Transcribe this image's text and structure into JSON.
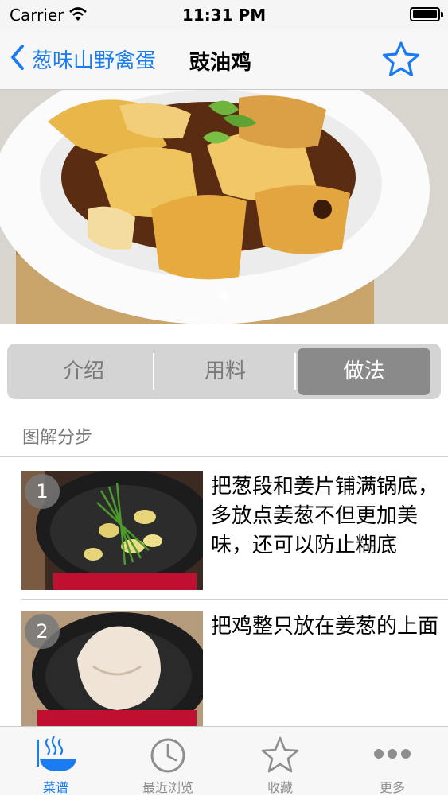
{
  "status_bar": {
    "carrier": "Carrier",
    "time": "11:31 PM"
  },
  "nav": {
    "back_label": "葱味山野禽蛋",
    "title": "豉油鸡"
  },
  "segments": [
    {
      "label": "介绍",
      "active": false
    },
    {
      "label": "用料",
      "active": false
    },
    {
      "label": "做法",
      "active": true
    }
  ],
  "section_title": "图解分步",
  "steps": [
    {
      "number": "1",
      "text": "把葱段和姜片铺满锅底，多放点姜葱不但更加美味，还可以防止糊底"
    },
    {
      "number": "2",
      "text": "把鸡整只放在姜葱的上面"
    }
  ],
  "tabs": [
    {
      "label": "菜谱",
      "icon": "bowl-icon",
      "active": true
    },
    {
      "label": "最近浏览",
      "icon": "clock-icon",
      "active": false
    },
    {
      "label": "收藏",
      "icon": "star-icon",
      "active": false
    },
    {
      "label": "更多",
      "icon": "more-icon",
      "active": false
    }
  ],
  "colors": {
    "accent": "#1a7cf0",
    "segment_active": "#8a8a8a",
    "segment_bg": "#d4d4d4"
  }
}
